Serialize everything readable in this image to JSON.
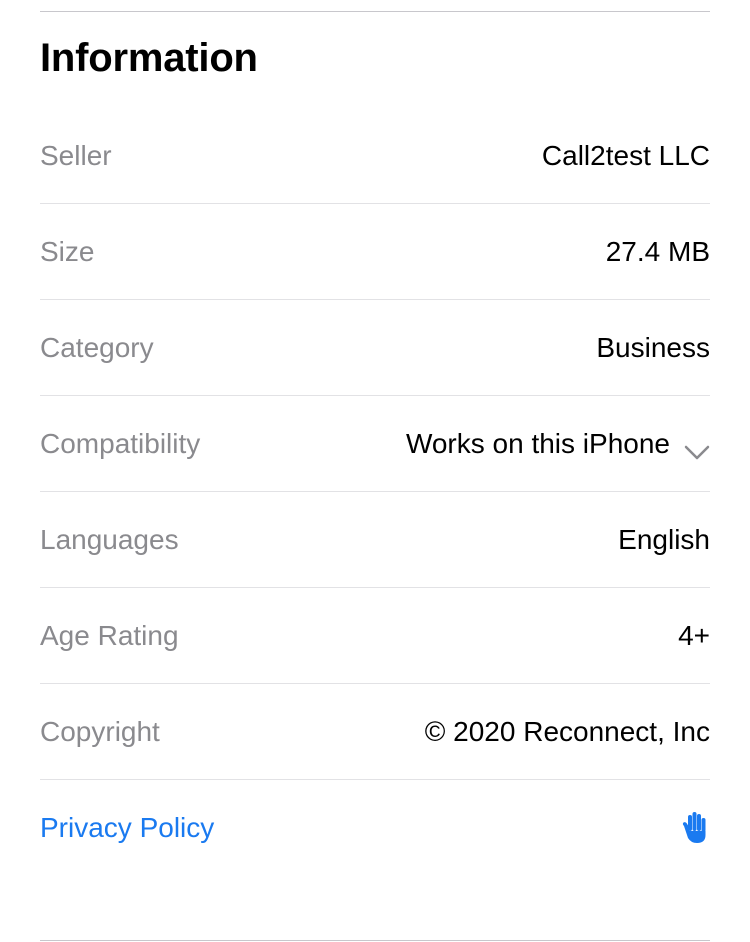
{
  "section": {
    "title": "Information"
  },
  "rows": [
    {
      "label": "Seller",
      "value": "Call2test LLC"
    },
    {
      "label": "Size",
      "value": "27.4 MB"
    },
    {
      "label": "Category",
      "value": "Business"
    },
    {
      "label": "Compatibility",
      "value": "Works on this iPhone",
      "icon": "chevron-down-icon"
    },
    {
      "label": "Languages",
      "value": "English"
    },
    {
      "label": "Age Rating",
      "value": "4+"
    },
    {
      "label": "Copyright",
      "value": "© 2020 Reconnect, Inc"
    }
  ],
  "privacy": {
    "label": "Privacy Policy",
    "icon": "hand-raised-icon",
    "color": "#1a7af0"
  },
  "colors": {
    "label_gray": "#8a8a8e",
    "value_black": "#000000",
    "link_blue": "#1a7af0"
  }
}
